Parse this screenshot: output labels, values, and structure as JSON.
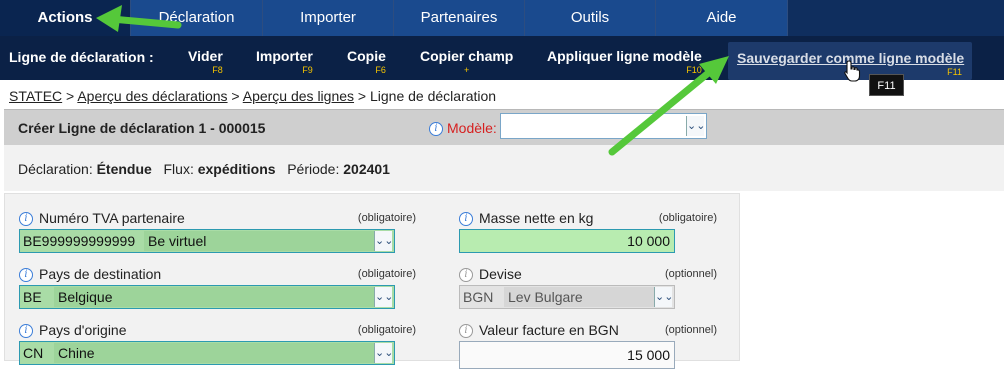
{
  "topnav": {
    "tabs": [
      {
        "label": "Actions",
        "active": true
      },
      {
        "label": "Déclaration"
      },
      {
        "label": "Importer"
      },
      {
        "label": "Partenaires"
      },
      {
        "label": "Outils"
      },
      {
        "label": "Aide"
      }
    ]
  },
  "toolbar": {
    "label": "Ligne de déclaration :",
    "items": [
      {
        "label": "Vider",
        "key": "F8"
      },
      {
        "label": "Importer",
        "key": "F9"
      },
      {
        "label": "Copie",
        "key": "F6"
      },
      {
        "label": "Copier champ",
        "key": "+"
      },
      {
        "label": "Appliquer ligne modèle",
        "key": "F10"
      },
      {
        "label": "Sauvegarder comme ligne modèle",
        "key": "F11"
      }
    ],
    "tooltip": "F11"
  },
  "breadcrumb": {
    "items": [
      "STATEC",
      "Aperçu des déclarations",
      "Aperçu des lignes"
    ],
    "sep": " > ",
    "current": "Ligne de déclaration"
  },
  "header": {
    "title": "Créer Ligne de déclaration 1 - 000015",
    "modele_label": "Modèle:",
    "modele_value": ""
  },
  "summary": {
    "declaration_label": "Déclaration:",
    "declaration_value": "Étendue",
    "flux_label": "Flux:",
    "flux_value": "expéditions",
    "periode_label": "Période:",
    "periode_value": "202401"
  },
  "fields": {
    "tva": {
      "label": "Numéro TVA partenaire",
      "req": "(obligatoire)",
      "code": "BE999999999999",
      "desc": "Be virtuel"
    },
    "masse": {
      "label": "Masse nette en kg",
      "req": "(obligatoire)",
      "value": "10 000"
    },
    "pays_dest": {
      "label": "Pays de destination",
      "req": "(obligatoire)",
      "code": "BE",
      "desc": "Belgique"
    },
    "devise": {
      "label": "Devise",
      "req": "(optionnel)",
      "code": "BGN",
      "desc": "Lev Bulgare"
    },
    "pays_orig": {
      "label": "Pays d'origine",
      "req": "(obligatoire)",
      "code": "CN",
      "desc": "Chine"
    },
    "valeur": {
      "label": "Valeur facture en BGN",
      "req": "(optionnel)",
      "value": "15 000"
    }
  },
  "icons": {
    "info": "info-icon",
    "dropdown": "chevron-down-icon",
    "cursor": "hand-pointer-icon",
    "annotation": "green-arrow-annotation"
  },
  "colors": {
    "nav_bg": "#0f2e5e",
    "accent_key": "#f5c400",
    "required_red": "#d62020",
    "field_green": "#a9dca6",
    "arrow_green": "#55c83a"
  }
}
